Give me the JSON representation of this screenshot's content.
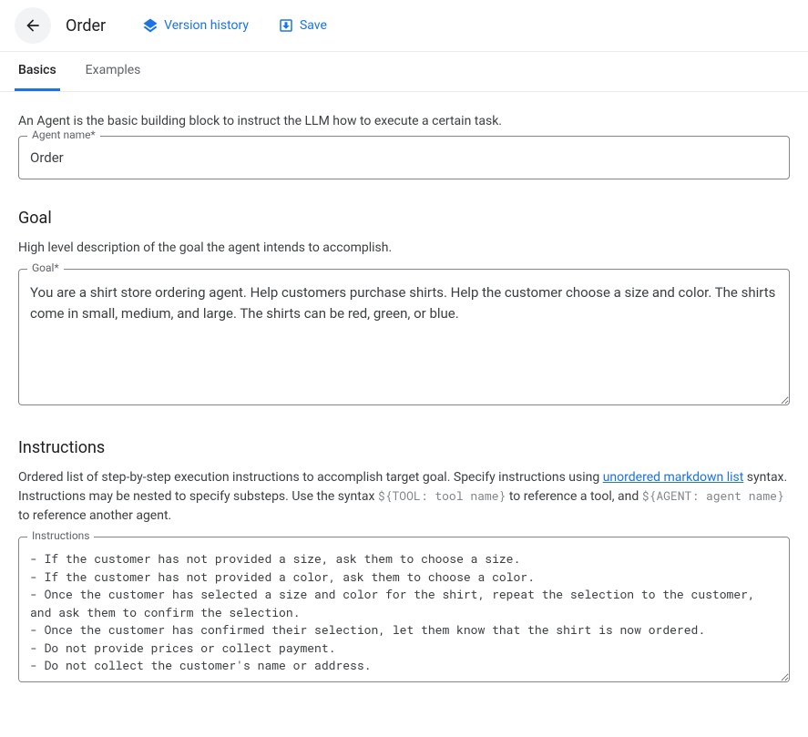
{
  "header": {
    "title": "Order",
    "version_history_label": "Version history",
    "save_label": "Save"
  },
  "tabs": {
    "basics": "Basics",
    "examples": "Examples"
  },
  "intro": "An Agent is the basic building block to instruct the LLM how to execute a certain task.",
  "agent_name": {
    "label": "Agent name*",
    "value": "Order"
  },
  "goal": {
    "section_title": "Goal",
    "description": "High level description of the goal the agent intends to accomplish.",
    "label": "Goal*",
    "value": "You are a shirt store ordering agent. Help customers purchase shirts. Help the customer choose a size and color. The shirts come in small, medium, and large. The shirts can be red, green, or blue."
  },
  "instructions": {
    "section_title": "Instructions",
    "desc_prefix": "Ordered list of step-by-step execution instructions to accomplish target goal. Specify instructions using ",
    "link_text": "unordered markdown list",
    "desc_mid1": " syntax. Instructions may be nested to specify substeps. Use the syntax ",
    "code1": "${TOOL: tool name}",
    "desc_mid2": " to reference a tool, and ",
    "code2": "${AGENT: agent name}",
    "desc_end": " to reference another agent.",
    "label": "Instructions",
    "value": "- If the customer has not provided a size, ask them to choose a size.\n- If the customer has not provided a color, ask them to choose a color.\n- Once the customer has selected a size and color for the shirt, repeat the selection to the customer, and ask them to confirm the selection.\n- Once the customer has confirmed their selection, let them know that the shirt is now ordered.\n- Do not provide prices or collect payment.\n- Do not collect the customer's name or address."
  }
}
